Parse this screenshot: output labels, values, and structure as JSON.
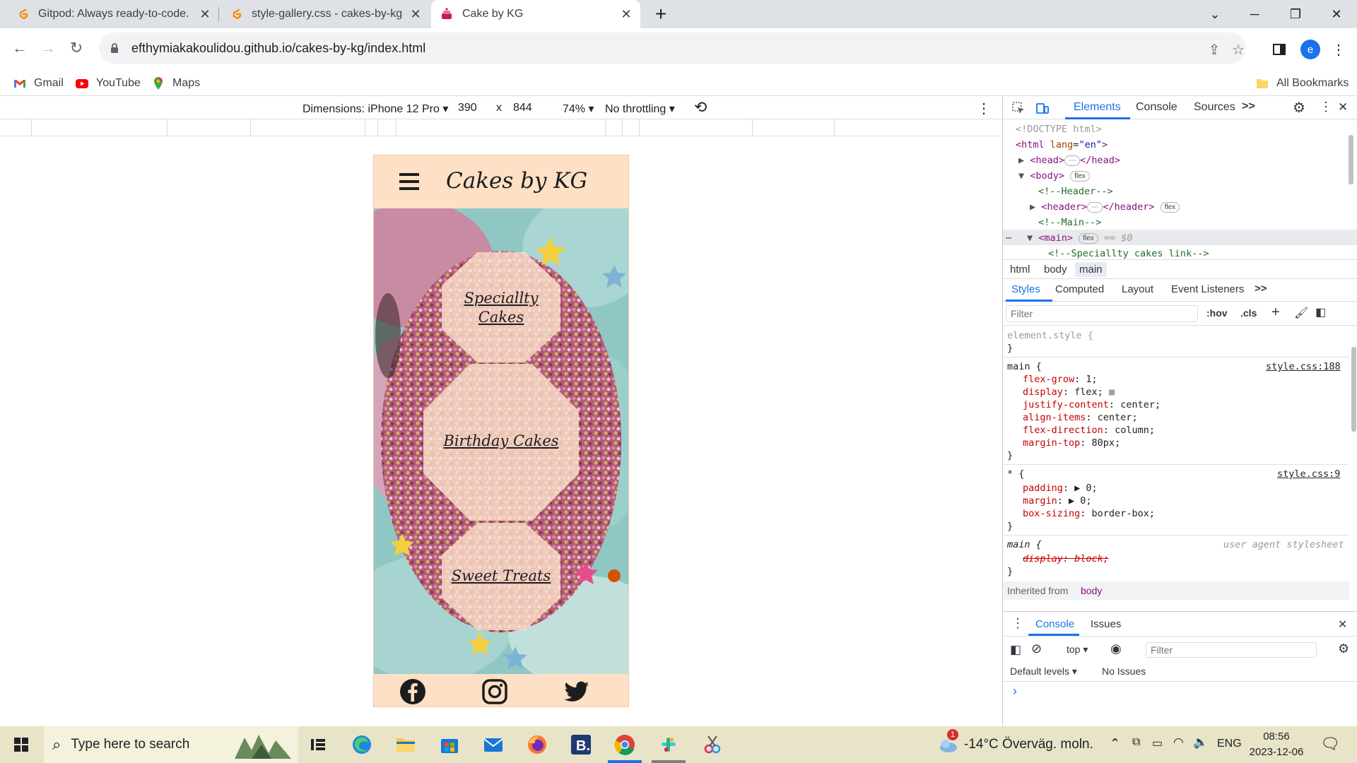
{
  "browser": {
    "tabs": [
      {
        "title": "Gitpod: Always ready-to-code.",
        "icon": "gitpod-icon",
        "active": false
      },
      {
        "title": "style-gallery.css - cakes-by-kg -",
        "icon": "gitpod-icon",
        "active": false
      },
      {
        "title": "Cake by KG",
        "icon": "cake-icon",
        "active": true
      }
    ],
    "url": "efthymiakakoulidou.github.io/cakes-by-kg/index.html",
    "profile_initial": "e",
    "bookmarks": [
      "Gmail",
      "YouTube",
      "Maps"
    ],
    "all_bookmarks": "All Bookmarks"
  },
  "device_toolbar": {
    "dimensions": "Dimensions: iPhone 12 Pro",
    "width": "390",
    "times": "x",
    "height": "844",
    "zoom": "74%",
    "throttling": "No throttling"
  },
  "site": {
    "title": "Cakes by KG",
    "links": [
      {
        "line1": "Speciallty",
        "line2": "Cakes"
      },
      {
        "line1": "Birthday Cakes",
        "line2": ""
      },
      {
        "line1": "Sweet Treats",
        "line2": ""
      }
    ],
    "social": [
      "facebook-icon",
      "instagram-icon",
      "twitter-icon"
    ]
  },
  "devtools": {
    "tabs": [
      "Elements",
      "Console",
      "Sources"
    ],
    "more": ">>",
    "dom": {
      "doctype": "<!DOCTYPE html>",
      "html_open": "<html",
      "html_attr": "lang",
      "html_val": "\"en\"",
      "head": "<head>",
      "head_close": "</head>",
      "body": "<body>",
      "flex": "flex",
      "comment_header": "<!--Header-->",
      "header": "<header>",
      "header_close": "</header>",
      "comment_main": "<!--Main-->",
      "main": "<main>",
      "main_eq": "== $0",
      "comment_specialty": "<!--Speciallty cakes link-->"
    },
    "breadcrumbs": [
      "html",
      "body",
      "main"
    ],
    "styles_tabs": [
      "Styles",
      "Computed",
      "Layout",
      "Event Listeners"
    ],
    "filter_placeholder": "Filter",
    "hov": ":hov",
    "cls": ".cls",
    "rules": {
      "element_style": "element.style {",
      "close": "}",
      "main_sel": "main {",
      "main_src": "style.css:188",
      "main_props": [
        {
          "p": "flex-grow",
          "v": "1;"
        },
        {
          "p": "display",
          "v": "flex;"
        },
        {
          "p": "justify-content",
          "v": "center;"
        },
        {
          "p": "align-items",
          "v": "center;"
        },
        {
          "p": "flex-direction",
          "v": "column;"
        },
        {
          "p": "margin-top",
          "v": "80px;"
        }
      ],
      "star_sel": "* {",
      "star_src": "style.css:9",
      "star_props": [
        {
          "p": "padding",
          "v": "0;"
        },
        {
          "p": "margin",
          "v": "0;"
        },
        {
          "p": "box-sizing",
          "v": "border-box;"
        }
      ],
      "ua_sel": "main {",
      "ua_src": "user agent stylesheet",
      "ua_prop": "display: block;",
      "inherited": "Inherited from",
      "inherited_el": "body"
    },
    "drawer": {
      "tabs": [
        "Console",
        "Issues"
      ],
      "context": "top",
      "filter_placeholder": "Filter",
      "levels": "Default levels",
      "issues": "No Issues",
      "prompt": "›"
    }
  },
  "taskbar": {
    "search_placeholder": "Type here to search",
    "weather": "-14°C  Överväg. moln.",
    "weather_badge": "1",
    "lang": "ENG",
    "time": "08:56",
    "date": "2023-12-06"
  }
}
